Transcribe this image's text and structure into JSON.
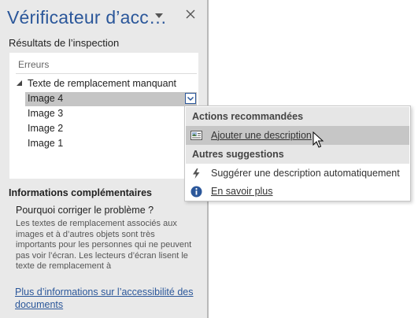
{
  "pane": {
    "title": "Vérificateur d’acc…",
    "results_label": "Résultats de l’inspection",
    "results": {
      "header": "Erreurs",
      "group_label": "Texte de remplacement manquant",
      "items": [
        "Image 4",
        "Image 3",
        "Image 2",
        "Image 1"
      ],
      "selected_item": "Image 4"
    },
    "more_info_title": "Informations complémentaires",
    "why_title": "Pourquoi corriger le problème ?",
    "why_body": "Les textes de remplacement associés aux images et à d’autres objets sont très importants pour les personnes qui ne peuvent pas voir l’écran. Les lecteurs d’écran lisent le texte de remplacement à",
    "more_link": "Plus d’informations sur l’accessibilité des documents"
  },
  "menu": {
    "recommended_header": "Actions recommandées",
    "add_description": "Ajouter une description",
    "other_header": "Autres suggestions",
    "suggest_auto": "Suggérer une description automatiquement",
    "learn_more": "En savoir plus"
  },
  "colors": {
    "accent": "#2b579a",
    "pane_bg": "#e9e9e9",
    "selection": "#c5c5c5"
  }
}
